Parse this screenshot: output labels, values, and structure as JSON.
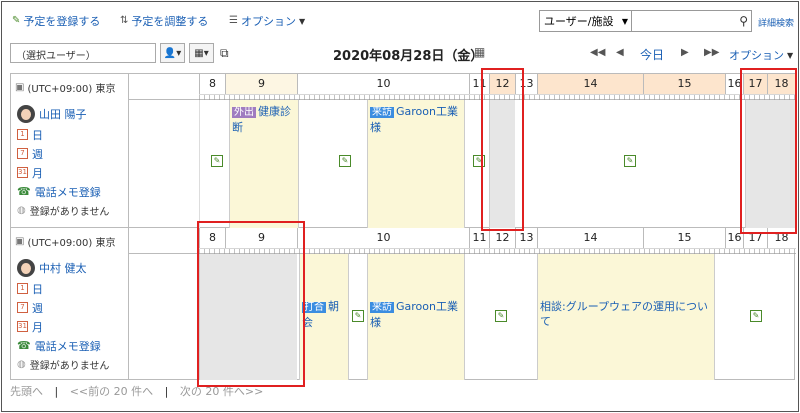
{
  "toolbar": {
    "register": "予定を登録する",
    "adjust": "予定を調整する",
    "options": "オプション"
  },
  "search": {
    "select_value": "ユーザー/施設",
    "detailed": "詳細検索"
  },
  "view": {
    "user_select": "（選択ユーザー）",
    "date": "2020年08月28日（金）",
    "today": "今日",
    "options": "オプション"
  },
  "hours": [
    "8",
    "9",
    "10",
    "11",
    "12",
    "13",
    "14",
    "15",
    "16",
    "17",
    "18"
  ],
  "timezone": "(UTC+09:00) 東京",
  "users": [
    {
      "name": "山田 陽子",
      "links": [
        "日",
        "週",
        "月",
        "電話メモ登録",
        "登録がありません"
      ],
      "events": [
        {
          "tag": "外出",
          "title": "健康診断"
        },
        {
          "tag": "来訪",
          "title": "Garoon工業様"
        }
      ]
    },
    {
      "name": "中村 健太",
      "links": [
        "日",
        "週",
        "月",
        "電話メモ登録",
        "登録がありません"
      ],
      "events": [
        {
          "tag": "打合",
          "title": "朝会"
        },
        {
          "tag": "来訪",
          "title": "Garoon工業様"
        },
        {
          "tag": "",
          "title": "相談:グループウェアの運用について"
        }
      ]
    }
  ],
  "pager": {
    "first": "先頭へ",
    "prev": "<<前の 20 件へ",
    "next": "次の 20 件へ>>",
    "sep": "|"
  },
  "icons": {
    "cal_day": "1",
    "cal_week": "7",
    "cal_month": "31"
  }
}
